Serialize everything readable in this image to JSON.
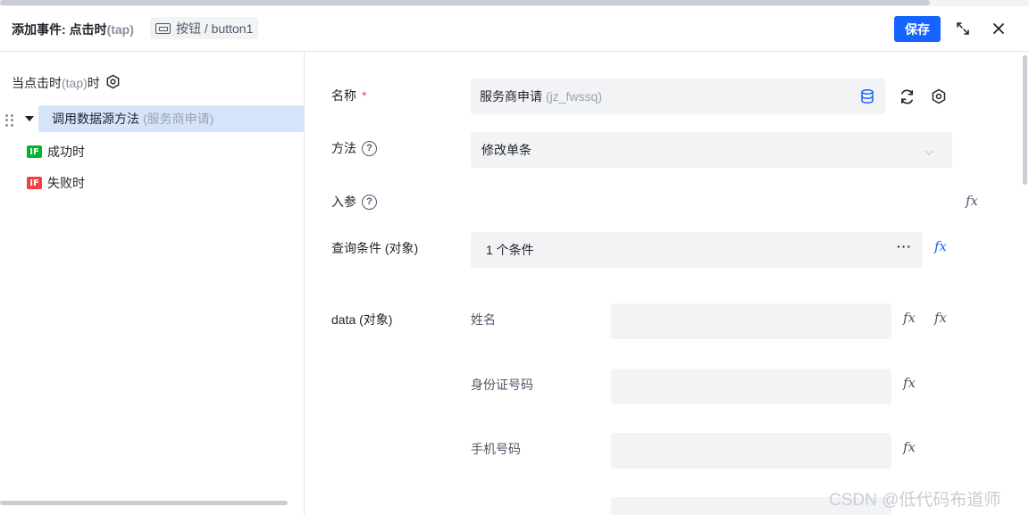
{
  "header": {
    "title_prefix": "添加事件: 点击时",
    "title_trigger": "(tap)",
    "component_label": "按钮 / button1",
    "save_label": "保存"
  },
  "left": {
    "trigger_prefix": "当点击时",
    "trigger_event": "(tap)",
    "trigger_suffix": "时",
    "action_label": "调用数据源方法",
    "action_datasource": "(服务商申请)",
    "success_badge": "IF",
    "success_label": "成功时",
    "fail_badge": "IF",
    "fail_label": "失败时"
  },
  "form": {
    "name_label": "名称",
    "name_required": "*",
    "name_value": "服务商申请",
    "name_code": "(jz_fwssq)",
    "method_label": "方法",
    "method_value": "修改单条",
    "params_label": "入参",
    "query_label": "查询条件 (对象)",
    "query_value": "1 个条件",
    "query_more": "···",
    "data_label": "data (对象)",
    "fields": [
      {
        "label": "姓名",
        "value": ""
      },
      {
        "label": "身份证号码",
        "value": ""
      },
      {
        "label": "手机号码",
        "value": ""
      },
      {
        "label": "",
        "value": ""
      }
    ],
    "fx": "fx",
    "help_glyph": "?"
  },
  "watermark": "CSDN @低代码布道师",
  "colors": {
    "primary": "#1664ff",
    "success": "#00b42a",
    "danger": "#f53f3f",
    "selected_bg": "#d6e4fb",
    "field_bg": "#f2f3f5"
  },
  "icons": [
    "expand-icon",
    "close-icon",
    "settings-icon",
    "database-icon",
    "refresh-icon",
    "chevron-down-icon",
    "question-icon",
    "fx-icon",
    "drag-handle-icon"
  ]
}
